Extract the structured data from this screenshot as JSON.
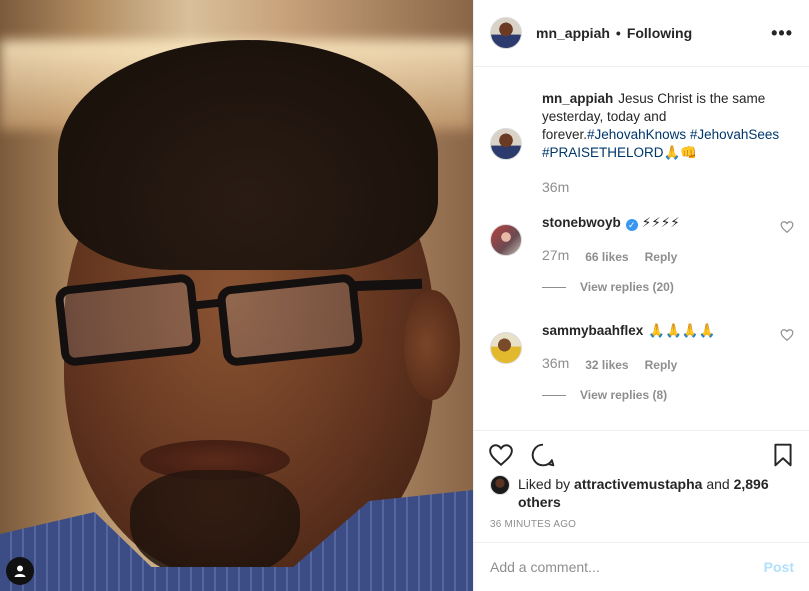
{
  "post": {
    "author": "mn_appiah",
    "follow_status": "Following",
    "more_icon": "more-options-icon",
    "caption_author": "mn_appiah",
    "caption_text": "Jesus Christ is the same yesterday, today and forever.",
    "caption_tags": "#JehovahKnows #JehovahSees #PRAISETHELORD",
    "caption_emoji": "🙏👊",
    "caption_time": "36m"
  },
  "comments": [
    {
      "username": "stonebwoyb",
      "verified": true,
      "text": "⚡⚡⚡⚡",
      "time": "27m",
      "likes": "66 likes",
      "reply": "Reply",
      "view_replies": "View replies (20)"
    },
    {
      "username": "sammybaahflex",
      "verified": false,
      "text": "🙏🙏🙏🙏",
      "time": "36m",
      "likes": "32 likes",
      "reply": "Reply",
      "view_replies": "View replies (8)"
    }
  ],
  "likes": {
    "prefix": "Liked by",
    "liker": "attractivemustapha",
    "conjunction": "and",
    "others": "2,896 others"
  },
  "timestamp": "36 MINUTES AGO",
  "add_comment": {
    "placeholder": "Add a comment...",
    "post_label": "Post"
  },
  "colors": {
    "hashtag": "#00376b",
    "meta_gray": "#8e8e8e",
    "post_button": "#b2dffc",
    "verified": "#3897f0"
  },
  "icons": [
    "heart-icon",
    "comment-icon",
    "bookmark-icon",
    "user-tag-icon",
    "verified-badge-icon"
  ]
}
